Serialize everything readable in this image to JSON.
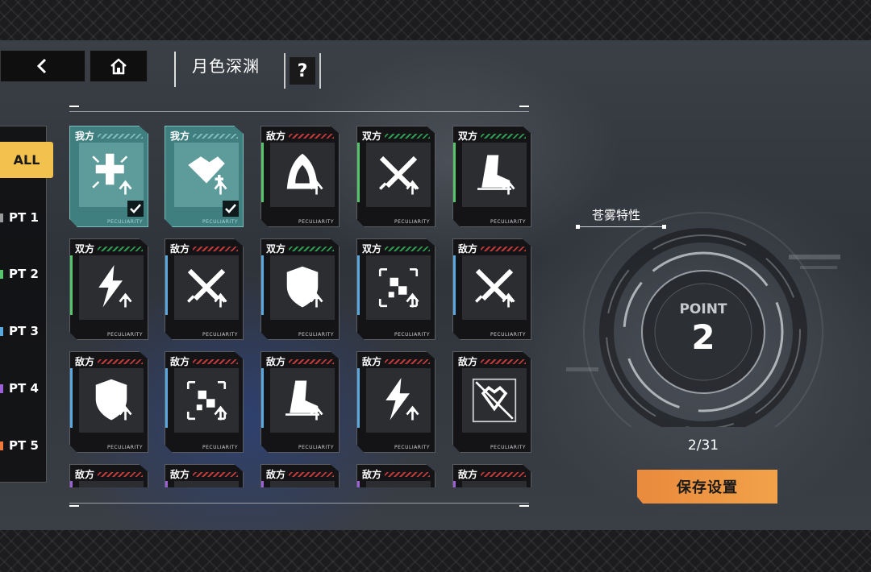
{
  "header": {
    "title": "月色深渊",
    "back_icon": "chevron-left-icon",
    "home_icon": "home-icon",
    "help_label": "?"
  },
  "filters": [
    {
      "label": "ALL",
      "active": true,
      "color": "#f2c14e"
    },
    {
      "label": "PT 1",
      "color": "#9a9a9a"
    },
    {
      "label": "PT 2",
      "color": "#55c46a"
    },
    {
      "label": "PT 3",
      "color": "#5aa8e0"
    },
    {
      "label": "PT 4",
      "color": "#9b5fd6"
    },
    {
      "label": "PT 5",
      "color": "#f07a3a"
    }
  ],
  "cards": [
    {
      "tag": "我方",
      "icon": "resist-up-icon",
      "owned": true,
      "selected": true,
      "side": "none",
      "stripe": "#7fbcbc"
    },
    {
      "tag": "我方",
      "icon": "heal-plus-icon",
      "owned": true,
      "selected": true,
      "side": "none",
      "stripe": "#7fbcbc"
    },
    {
      "tag": "敌方",
      "icon": "hood-icon",
      "owned": false,
      "selected": false,
      "side": "#55c46a",
      "stripe": "#c03a3a"
    },
    {
      "tag": "双方",
      "icon": "crossed-swords-icon",
      "owned": false,
      "selected": false,
      "side": "#55c46a",
      "stripe": "#2f9a52"
    },
    {
      "tag": "双方",
      "icon": "boot-speed-icon",
      "owned": false,
      "selected": false,
      "side": "#55c46a",
      "stripe": "#2f9a52"
    },
    {
      "tag": "双方",
      "icon": "lightning-icon",
      "owned": false,
      "selected": false,
      "side": "#55c46a",
      "stripe": "#2f9a52"
    },
    {
      "tag": "敌方",
      "icon": "crossed-swords-icon",
      "owned": false,
      "selected": false,
      "side": "#5aa8e0",
      "stripe": "#c03a3a"
    },
    {
      "tag": "双方",
      "icon": "shield-icon",
      "owned": false,
      "selected": false,
      "side": "#5aa8e0",
      "stripe": "#2f9a52"
    },
    {
      "tag": "双方",
      "icon": "target-scan-icon",
      "owned": false,
      "selected": false,
      "side": "#5aa8e0",
      "stripe": "#2f9a52"
    },
    {
      "tag": "敌方",
      "icon": "crossed-swords-icon",
      "owned": false,
      "selected": false,
      "side": "#5aa8e0",
      "stripe": "#c03a3a"
    },
    {
      "tag": "敌方",
      "icon": "shield-icon",
      "owned": false,
      "selected": false,
      "side": "#5aa8e0",
      "stripe": "#c03a3a"
    },
    {
      "tag": "敌方",
      "icon": "target-scan-icon",
      "owned": false,
      "selected": false,
      "side": "#5aa8e0",
      "stripe": "#c03a3a"
    },
    {
      "tag": "敌方",
      "icon": "boot-speed-icon",
      "owned": false,
      "selected": false,
      "side": "#5aa8e0",
      "stripe": "#c03a3a"
    },
    {
      "tag": "敌方",
      "icon": "lightning-icon",
      "owned": false,
      "selected": false,
      "side": "#5aa8e0",
      "stripe": "#c03a3a"
    },
    {
      "tag": "敌方",
      "icon": "no-heal-icon",
      "owned": false,
      "selected": false,
      "side": "none",
      "stripe": "#c03a3a"
    },
    {
      "tag": "敌方",
      "icon": "unknown-icon",
      "owned": false,
      "selected": false,
      "side": "#9b5fd6",
      "stripe": "#c03a3a"
    },
    {
      "tag": "敌方",
      "icon": "unknown-icon",
      "owned": false,
      "selected": false,
      "side": "#9b5fd6",
      "stripe": "#c03a3a"
    },
    {
      "tag": "敌方",
      "icon": "unknown-icon",
      "owned": false,
      "selected": false,
      "side": "#9b5fd6",
      "stripe": "#c03a3a"
    },
    {
      "tag": "敌方",
      "icon": "unknown-icon",
      "owned": false,
      "selected": false,
      "side": "#9b5fd6",
      "stripe": "#c03a3a"
    },
    {
      "tag": "敌方",
      "icon": "unknown-icon",
      "owned": false,
      "selected": false,
      "side": "#9b5fd6",
      "stripe": "#c03a3a"
    }
  ],
  "card_footer": "PECULIARITY",
  "right_panel": {
    "title": "苍雾特性",
    "point_label": "POINT",
    "point_value": "2",
    "counter": "2/31",
    "save_label": "保存设置"
  }
}
